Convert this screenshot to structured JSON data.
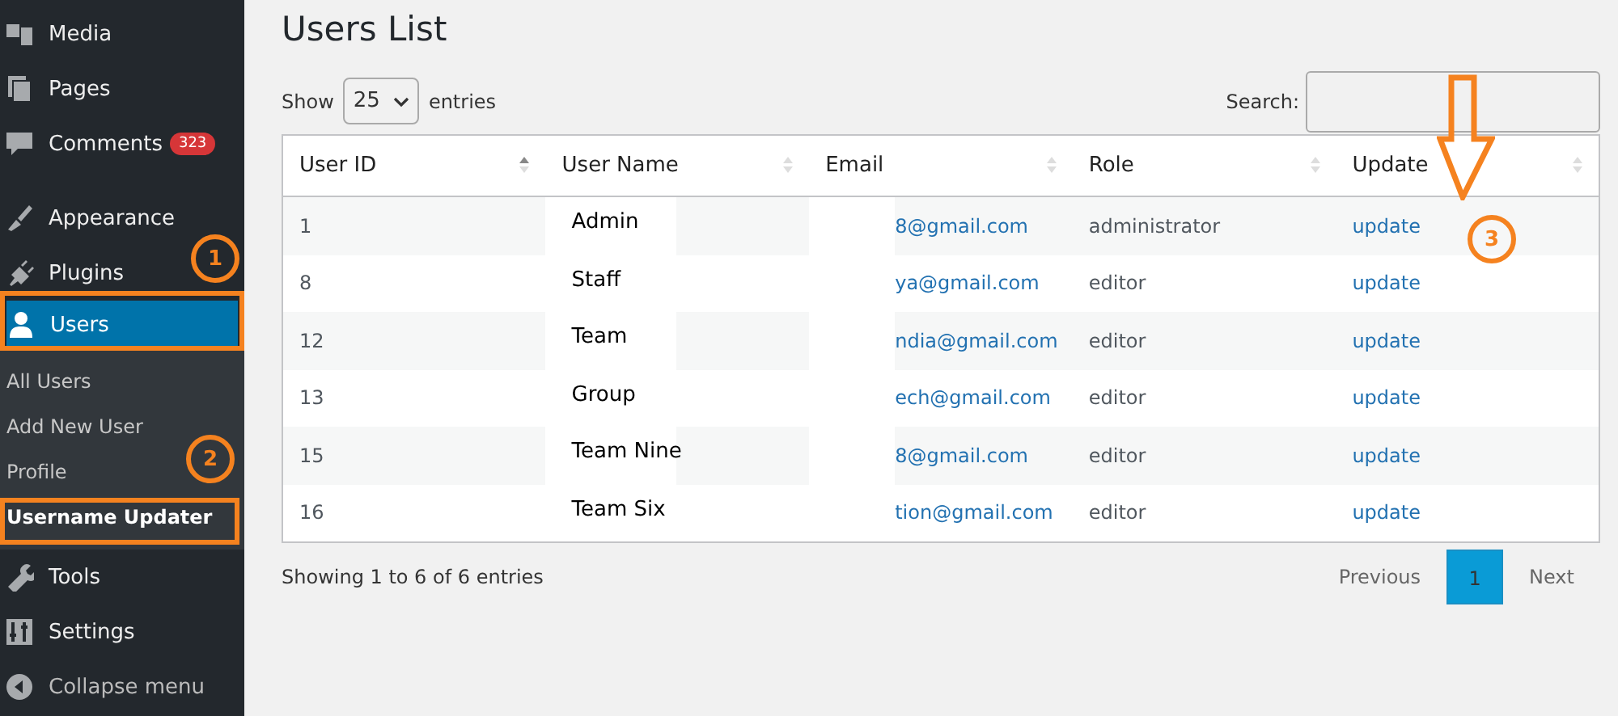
{
  "sidebar": {
    "items": [
      {
        "label": "Media",
        "selected": false
      },
      {
        "label": "Pages",
        "selected": false
      },
      {
        "label": "Comments",
        "badge": "323",
        "selected": false
      },
      {
        "label": "Appearance",
        "selected": false
      },
      {
        "label": "Plugins",
        "selected": false
      },
      {
        "label": "Users",
        "selected": true,
        "children": [
          {
            "label": "All Users",
            "selected": false
          },
          {
            "label": "Add New User",
            "selected": false
          },
          {
            "label": "Profile",
            "selected": false
          },
          {
            "label": "Username Updater",
            "selected": true
          }
        ]
      },
      {
        "label": "Tools",
        "selected": false
      },
      {
        "label": "Settings",
        "selected": false
      },
      {
        "label": "Collapse menu",
        "selected": false
      }
    ]
  },
  "page_title": "Users List",
  "length_control": {
    "before": "Show",
    "value": "25",
    "after": "entries"
  },
  "search": {
    "label": "Search:"
  },
  "table": {
    "columns": [
      {
        "label": "User ID",
        "sorted": true
      },
      {
        "label": "User Name",
        "sorted": false
      },
      {
        "label": "Email",
        "sorted": false
      },
      {
        "label": "Role",
        "sorted": false
      },
      {
        "label": "Update",
        "sorted": false
      }
    ],
    "rows": [
      {
        "id": "1",
        "name": "Admin",
        "email": "8@gmail.com",
        "role": "administrator",
        "action": "update"
      },
      {
        "id": "8",
        "name": "Staff",
        "email": "ya@gmail.com",
        "role": "editor",
        "action": "update"
      },
      {
        "id": "12",
        "name": "Team",
        "email": "ndia@gmail.com",
        "role": "editor",
        "action": "update"
      },
      {
        "id": "13",
        "name": "Group",
        "email": "ech@gmail.com",
        "role": "editor",
        "action": "update"
      },
      {
        "id": "15",
        "name": "Team Nine",
        "email": "8@gmail.com",
        "role": "editor",
        "action": "update"
      },
      {
        "id": "16",
        "name": "Team Six",
        "email": "tion@gmail.com",
        "role": "editor",
        "action": "update"
      }
    ]
  },
  "info": "Showing 1 to 6 of 6 entries",
  "pagination": [
    {
      "label": "Previous",
      "kind": "prev",
      "selected": false
    },
    {
      "label": "1",
      "kind": "page",
      "selected": true
    },
    {
      "label": "Next",
      "kind": "next",
      "selected": false
    }
  ],
  "markers": [
    {
      "label": "1"
    },
    {
      "label": "2"
    },
    {
      "label": "3"
    }
  ]
}
